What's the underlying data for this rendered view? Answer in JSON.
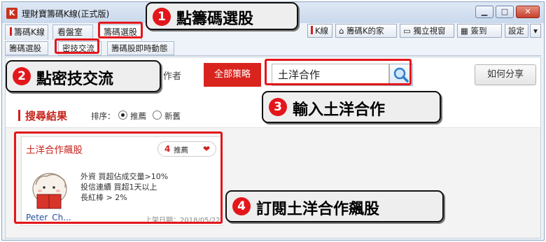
{
  "window": {
    "app_icon": "K",
    "title": "理財寶籌碼K線(正式版)",
    "controls": [
      "▁",
      "□",
      "✕"
    ]
  },
  "tabs": [
    {
      "label": "籌碼K線"
    },
    {
      "label": "看盤室"
    },
    {
      "label": "籌碼選股"
    }
  ],
  "toolbar": {
    "kline": "K線",
    "home": "籌碼K的家",
    "standalone": "獨立視窗",
    "checkin": "簽到",
    "settings": "設定",
    "settings_arrow": "▾"
  },
  "subtabs": [
    {
      "label": "籌碼選股"
    },
    {
      "label": "密技交流"
    },
    {
      "label": "籌碼股即時動態"
    }
  ],
  "filters": {
    "author_partial": "作者",
    "all_strategies": "全部策略"
  },
  "search": {
    "value": "土洋合作"
  },
  "share_button": "如何分享",
  "results": {
    "title": "搜尋結果",
    "sort_label": "排序：",
    "sort_options": [
      {
        "label": "推薦",
        "checked": true
      },
      {
        "label": "新舊",
        "checked": false
      }
    ]
  },
  "card": {
    "name": "土洋合作飆股",
    "recommend_count": "4",
    "recommend_label": "推薦",
    "conditions": [
      "外資 買超佔成交量>10%",
      "投信連續 買超1天以上",
      "長紅棒 > 2%"
    ],
    "author": "Peter_Ch...",
    "date": "上架日期：2018/05/22"
  },
  "callouts": [
    {
      "num": "1",
      "text": "點籌碼選股"
    },
    {
      "num": "2",
      "text": "點密技交流"
    },
    {
      "num": "3",
      "text": "輸入土洋合作"
    },
    {
      "num": "4",
      "text": "訂閱土洋合作飆股"
    }
  ],
  "colors": {
    "accent_red": "#d9241e",
    "highlight_red": "#e3161b",
    "link_blue": "#2a4f9f"
  }
}
